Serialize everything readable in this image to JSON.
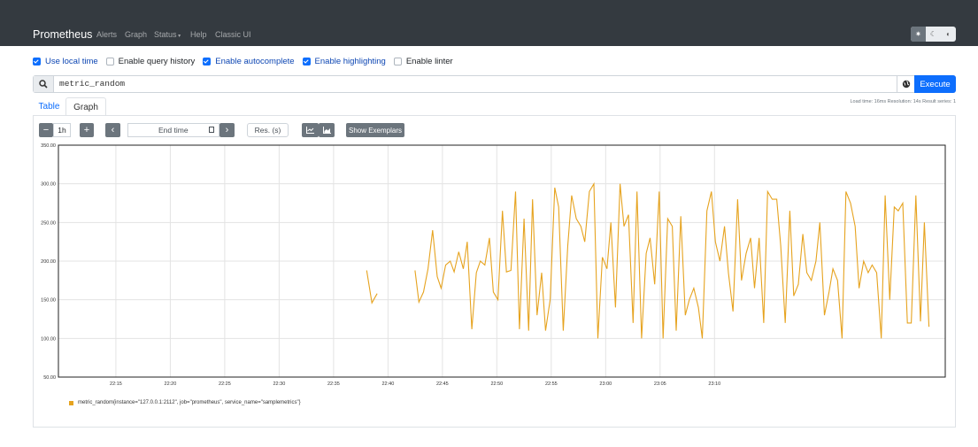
{
  "navbar": {
    "brand": "Prometheus",
    "items": [
      "Alerts",
      "Graph",
      "Status",
      "Help",
      "Classic UI"
    ],
    "theme_icons": [
      "sun-icon",
      "moon-icon",
      "contrast-icon"
    ]
  },
  "options": [
    {
      "label": "Use local time",
      "checked": true
    },
    {
      "label": "Enable query history",
      "checked": false
    },
    {
      "label": "Enable autocomplete",
      "checked": true
    },
    {
      "label": "Enable highlighting",
      "checked": true
    },
    {
      "label": "Enable linter",
      "checked": false
    }
  ],
  "query": {
    "value": "metric_random",
    "execute_label": "Execute"
  },
  "tabs": {
    "table": "Table",
    "graph": "Graph"
  },
  "stats": "Load time: 16ms   Resolution: 14s   Result series: 1",
  "controls": {
    "minus": "−",
    "range": "1h",
    "plus": "+",
    "prev": "‹",
    "end_time": "End time",
    "next": "›",
    "resolution": "Res. (s)",
    "show_exemplars": "Show Exemplars"
  },
  "legend": {
    "series_prefix": "metric_random{instance=\"127.0.0.1:2112\", job=\"prometheus\", service_name=\"samplemetrics\"}"
  },
  "colors": {
    "accent": "#0d6efd",
    "series": "#e6a31f",
    "navbar": "#343a40"
  },
  "chart_data": {
    "type": "line",
    "yticks": [
      "350.00",
      "300.00",
      "250.00",
      "200.00",
      "150.00",
      "100.00",
      "50.00"
    ],
    "ylim": [
      50,
      350
    ],
    "xticks": [
      "22:15",
      "22:20",
      "22:25",
      "22:30",
      "22:35",
      "22:40",
      "22:45",
      "22:50",
      "22:55",
      "23:00",
      "23:05",
      "23:10"
    ],
    "series": [
      {
        "name": "metric_random{instance=\"127.0.0.1:2112\", job=\"prometheus\", service_name=\"samplemetrics\"}",
        "segments": [
          [
            [
              22.634,
              188
            ],
            [
              22.642,
              146
            ],
            [
              22.65,
              158
            ]
          ],
          [
            [
              22.708,
              188
            ],
            [
              22.714,
              147
            ],
            [
              22.721,
              160
            ],
            [
              22.728,
              190
            ],
            [
              22.735,
              240
            ],
            [
              22.742,
              180
            ],
            [
              22.748,
              165
            ],
            [
              22.755,
              195
            ],
            [
              22.762,
              200
            ],
            [
              22.768,
              186
            ],
            [
              22.775,
              212
            ],
            [
              22.782,
              190
            ],
            [
              22.788,
              225
            ],
            [
              22.795,
              112
            ],
            [
              22.802,
              185
            ],
            [
              22.808,
              200
            ],
            [
              22.815,
              195
            ],
            [
              22.822,
              230
            ],
            [
              22.828,
              160
            ],
            [
              22.835,
              150
            ],
            [
              22.842,
              265
            ],
            [
              22.848,
              186
            ],
            [
              22.855,
              188
            ],
            [
              22.862,
              290
            ],
            [
              22.868,
              112
            ],
            [
              22.875,
              255
            ],
            [
              22.882,
              110
            ],
            [
              22.888,
              280
            ],
            [
              22.895,
              130
            ],
            [
              22.902,
              185
            ],
            [
              22.908,
              110
            ],
            [
              22.915,
              150
            ],
            [
              22.922,
              295
            ],
            [
              22.928,
              270
            ],
            [
              22.935,
              110
            ],
            [
              22.942,
              220
            ],
            [
              22.948,
              285
            ],
            [
              22.955,
              255
            ],
            [
              22.962,
              245
            ],
            [
              22.968,
              225
            ],
            [
              22.975,
              290
            ],
            [
              22.982,
              300
            ],
            [
              22.988,
              100
            ],
            [
              22.995,
              205
            ],
            [
              23.002,
              190
            ],
            [
              23.008,
              250
            ],
            [
              23.015,
              140
            ],
            [
              23.022,
              300
            ],
            [
              23.028,
              245
            ],
            [
              23.035,
              260
            ],
            [
              23.042,
              120
            ],
            [
              23.048,
              290
            ],
            [
              23.055,
              100
            ],
            [
              23.062,
              210
            ],
            [
              23.068,
              230
            ],
            [
              23.075,
              170
            ],
            [
              23.082,
              290
            ],
            [
              23.088,
              100
            ],
            [
              23.095,
              255
            ],
            [
              23.102,
              245
            ],
            [
              23.108,
              110
            ],
            [
              23.115,
              258
            ],
            [
              23.122,
              130
            ],
            [
              23.128,
              150
            ],
            [
              23.135,
              165
            ],
            [
              23.142,
              140
            ],
            [
              23.148,
              100
            ],
            [
              23.155,
              265
            ],
            [
              23.162,
              290
            ],
            [
              23.168,
              225
            ],
            [
              23.175,
              200
            ],
            [
              23.182,
              245
            ],
            [
              23.188,
              185
            ],
            [
              23.195,
              135
            ],
            [
              23.202,
              280
            ],
            [
              23.208,
              175
            ],
            [
              23.215,
              210
            ],
            [
              23.222,
              230
            ],
            [
              23.228,
              165
            ],
            [
              23.235,
              230
            ],
            [
              23.242,
              120
            ],
            [
              23.248,
              290
            ],
            [
              23.255,
              280
            ],
            [
              23.262,
              280
            ],
            [
              23.268,
              220
            ],
            [
              23.275,
              120
            ],
            [
              23.282,
              265
            ],
            [
              23.288,
              155
            ],
            [
              23.295,
              170
            ],
            [
              23.302,
              235
            ],
            [
              23.308,
              185
            ],
            [
              23.315,
              175
            ],
            [
              23.322,
              200
            ],
            [
              23.328,
              250
            ],
            [
              23.335,
              130
            ],
            [
              23.342,
              160
            ],
            [
              23.348,
              190
            ],
            [
              23.355,
              175
            ],
            [
              23.362,
              100
            ],
            [
              23.368,
              290
            ],
            [
              23.375,
              275
            ],
            [
              23.382,
              245
            ],
            [
              23.388,
              165
            ],
            [
              23.395,
              200
            ],
            [
              23.402,
              185
            ],
            [
              23.408,
              195
            ],
            [
              23.415,
              185
            ],
            [
              23.422,
              100
            ],
            [
              23.428,
              285
            ],
            [
              23.435,
              150
            ],
            [
              23.442,
              270
            ],
            [
              23.448,
              265
            ],
            [
              23.455,
              275
            ],
            [
              23.462,
              120
            ],
            [
              23.468,
              120
            ],
            [
              23.475,
              285
            ],
            [
              23.482,
              122
            ],
            [
              23.488,
              250
            ],
            [
              23.495,
              115
            ]
          ]
        ]
      }
    ]
  }
}
